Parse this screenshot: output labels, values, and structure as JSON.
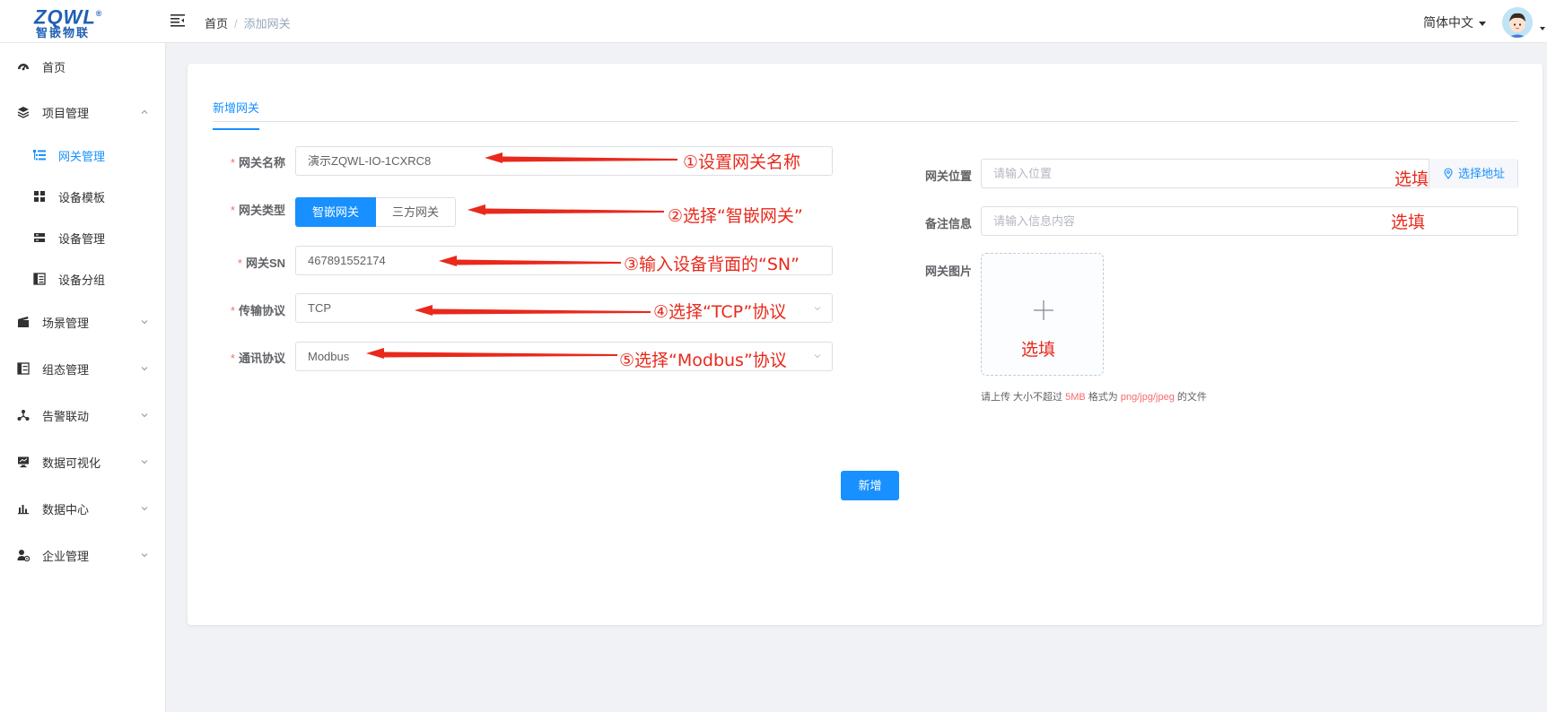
{
  "header": {
    "logo_main": "ZQWL",
    "logo_reg": "®",
    "logo_sub": "智嵌物联",
    "breadcrumb": {
      "home": "首页",
      "separator": "/",
      "current": "添加网关"
    },
    "language": "简体中文"
  },
  "sidebar": {
    "items": [
      {
        "label": "首页",
        "icon": "dashboard-icon"
      },
      {
        "label": "项目管理",
        "icon": "layers-icon",
        "expanded": true
      },
      {
        "label": "网关管理",
        "icon": "list-tree-icon",
        "active": true
      },
      {
        "label": "设备模板",
        "icon": "grid-icon"
      },
      {
        "label": "设备管理",
        "icon": "server-icon"
      },
      {
        "label": "设备分组",
        "icon": "group-icon"
      },
      {
        "label": "场景管理",
        "icon": "clapperboard-icon"
      },
      {
        "label": "组态管理",
        "icon": "config-icon"
      },
      {
        "label": "告警联动",
        "icon": "nodes-icon"
      },
      {
        "label": "数据可视化",
        "icon": "monitor-icon"
      },
      {
        "label": "数据中心",
        "icon": "bar-chart-icon"
      },
      {
        "label": "企业管理",
        "icon": "user-gear-icon"
      }
    ]
  },
  "tab": {
    "label": "新增网关"
  },
  "form": {
    "name": {
      "label": "网关名称",
      "value": "演示ZQWL-IO-1CXRC8"
    },
    "type": {
      "label": "网关类型",
      "option_on": "智嵌网关",
      "option_off": "三方网关"
    },
    "sn": {
      "label": "网关SN",
      "value": "467891552174"
    },
    "protocol": {
      "label": "传输协议",
      "value": "TCP"
    },
    "comm": {
      "label": "通讯协议",
      "value": "Modbus"
    },
    "location": {
      "label": "网关位置",
      "placeholder": "请输入位置",
      "button": "选择地址"
    },
    "remark": {
      "label": "备注信息",
      "placeholder": "请输入信息内容"
    },
    "image": {
      "label": "网关图片"
    },
    "upload_tip": {
      "prefix": "请上传 大小不超过 ",
      "size": "5MB",
      "mid": " 格式为 ",
      "formats": "png/jpg/jpeg",
      "suffix": " 的文件"
    },
    "submit": "新增"
  },
  "annotations": {
    "a1": "①设置网关名称",
    "a2": "②选择“智嵌网关”",
    "a3": "③输入设备背面的“SN”",
    "a4": "④选择“TCP”协议",
    "a5": "⑤选择“Modbus”协议",
    "opt_location": "选填",
    "opt_remark": "选填",
    "opt_image": "选填"
  },
  "colors": {
    "primary": "#1890ff",
    "annotation": "#e8291c",
    "required": "#f56c6c"
  }
}
